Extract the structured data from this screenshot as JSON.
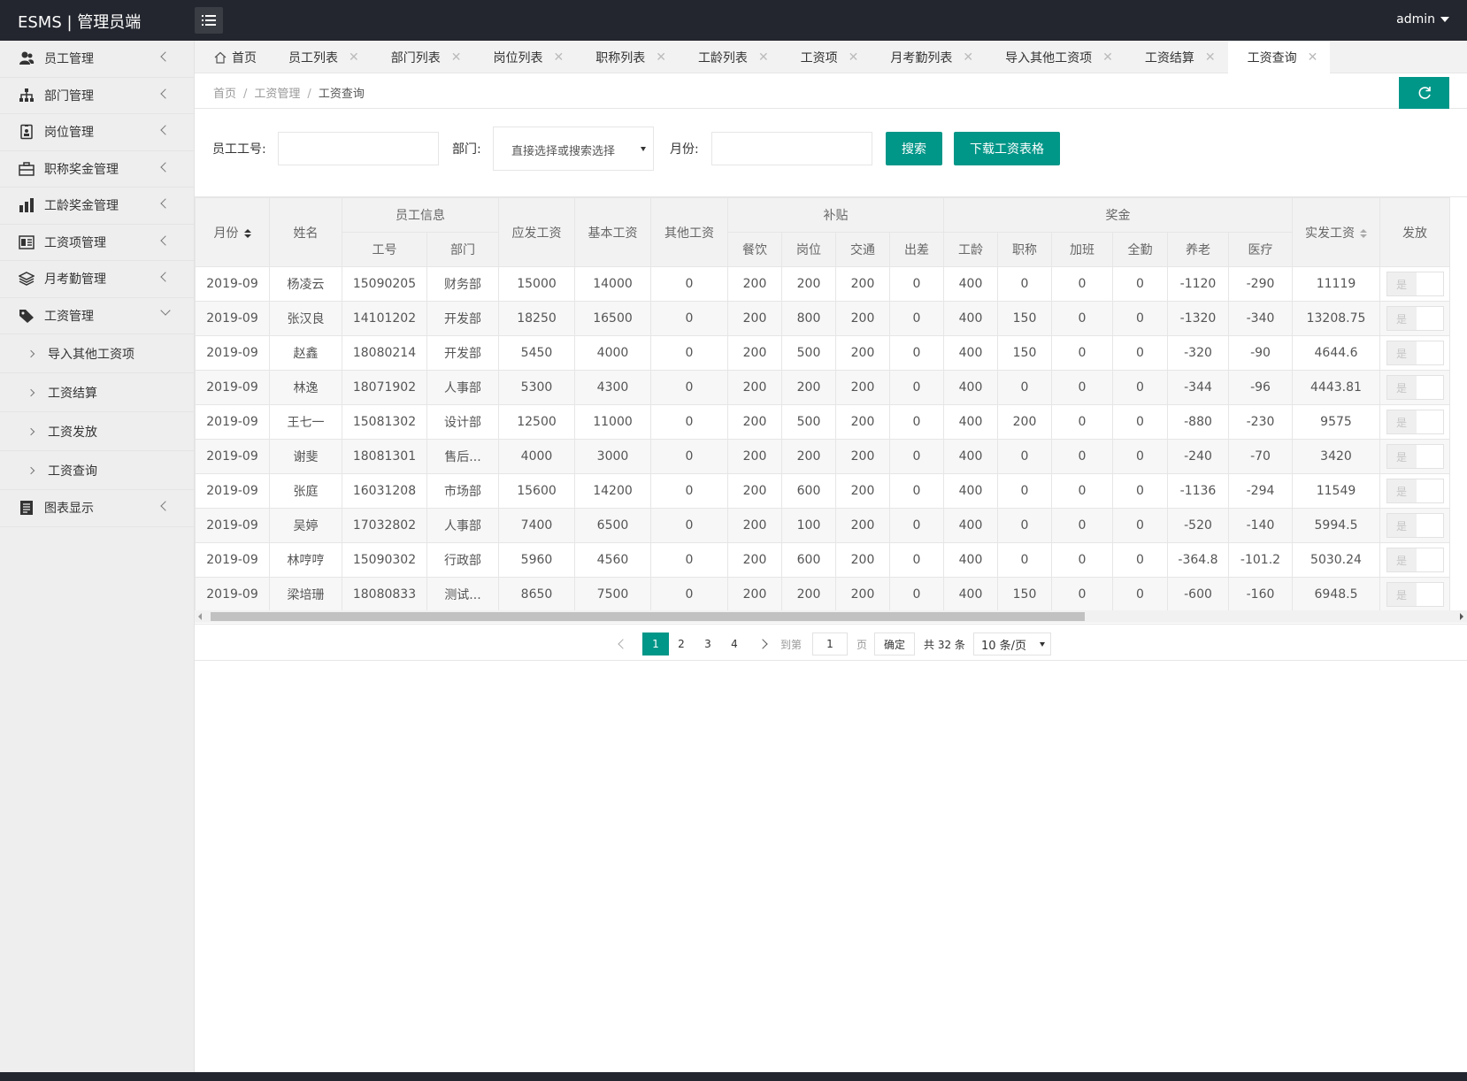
{
  "app": {
    "title": "ESMS | 管理员端",
    "user": "admin"
  },
  "sidebar": {
    "items": [
      {
        "label": "员工管理",
        "icon": "users-icon"
      },
      {
        "label": "部门管理",
        "icon": "sitemap-icon"
      },
      {
        "label": "岗位管理",
        "icon": "id-badge-icon"
      },
      {
        "label": "职称奖金管理",
        "icon": "briefcase-icon"
      },
      {
        "label": "工龄奖金管理",
        "icon": "chart-icon"
      },
      {
        "label": "工资项管理",
        "icon": "list-box-icon"
      },
      {
        "label": "月考勤管理",
        "icon": "layers-icon"
      },
      {
        "label": "工资管理",
        "icon": "tag-icon"
      }
    ],
    "subitems": [
      {
        "label": "导入其他工资项"
      },
      {
        "label": "工资结算"
      },
      {
        "label": "工资发放"
      },
      {
        "label": "工资查询"
      }
    ],
    "last": {
      "label": "图表显示",
      "icon": "report-icon"
    }
  },
  "tabs": [
    {
      "label": "首页"
    },
    {
      "label": "员工列表"
    },
    {
      "label": "部门列表"
    },
    {
      "label": "岗位列表"
    },
    {
      "label": "职称列表"
    },
    {
      "label": "工龄列表"
    },
    {
      "label": "工资项"
    },
    {
      "label": "月考勤列表"
    },
    {
      "label": "导入其他工资项"
    },
    {
      "label": "工资结算"
    },
    {
      "label": "工资查询"
    }
  ],
  "close_glyph": "✕",
  "breadcrumb": {
    "home": "首页",
    "sep": "/",
    "parent": "工资管理",
    "current": "工资查询"
  },
  "search": {
    "emp_label": "员工工号:",
    "emp_value": "",
    "dept_label": "部门:",
    "dept_placeholder": "直接选择或搜索选择",
    "month_label": "月份:",
    "month_value": "",
    "search_btn": "搜索",
    "download_btn": "下载工资表格"
  },
  "table": {
    "headers": {
      "month": "月份",
      "name": "姓名",
      "emp_info": "员工信息",
      "emp_no": "工号",
      "dept": "部门",
      "gross": "应发工资",
      "base": "基本工资",
      "other": "其他工资",
      "allowance": "补贴",
      "meal": "餐饮",
      "post": "岗位",
      "traffic": "交通",
      "trip": "出差",
      "bonus": "奖金",
      "seniority": "工龄",
      "title": "职称",
      "overtime": "加班",
      "attendance": "全勤",
      "pension": "养老",
      "medical": "医疗",
      "net": "实发工资",
      "issued": "发放"
    },
    "switch_label": "是",
    "rows": [
      [
        "2019-09",
        "杨凌云",
        "15090205",
        "财务部",
        "15000",
        "14000",
        "0",
        "200",
        "200",
        "200",
        "0",
        "400",
        "0",
        "0",
        "0",
        "-1120",
        "-290",
        "11119"
      ],
      [
        "2019-09",
        "张汉良",
        "14101202",
        "开发部",
        "18250",
        "16500",
        "0",
        "200",
        "800",
        "200",
        "0",
        "400",
        "150",
        "0",
        "0",
        "-1320",
        "-340",
        "13208.75"
      ],
      [
        "2019-09",
        "赵鑫",
        "18080214",
        "开发部",
        "5450",
        "4000",
        "0",
        "200",
        "500",
        "200",
        "0",
        "400",
        "150",
        "0",
        "0",
        "-320",
        "-90",
        "4644.6"
      ],
      [
        "2019-09",
        "林逸",
        "18071902",
        "人事部",
        "5300",
        "4300",
        "0",
        "200",
        "200",
        "200",
        "0",
        "400",
        "0",
        "0",
        "0",
        "-344",
        "-96",
        "4443.81"
      ],
      [
        "2019-09",
        "王七一",
        "15081302",
        "设计部",
        "12500",
        "11000",
        "0",
        "200",
        "500",
        "200",
        "0",
        "400",
        "200",
        "0",
        "0",
        "-880",
        "-230",
        "9575"
      ],
      [
        "2019-09",
        "谢斐",
        "18081301",
        "售后...",
        "4000",
        "3000",
        "0",
        "200",
        "200",
        "200",
        "0",
        "400",
        "0",
        "0",
        "0",
        "-240",
        "-70",
        "3420"
      ],
      [
        "2019-09",
        "张庭",
        "16031208",
        "市场部",
        "15600",
        "14200",
        "0",
        "200",
        "600",
        "200",
        "0",
        "400",
        "0",
        "0",
        "0",
        "-1136",
        "-294",
        "11549"
      ],
      [
        "2019-09",
        "吴婷",
        "17032802",
        "人事部",
        "7400",
        "6500",
        "0",
        "200",
        "100",
        "200",
        "0",
        "400",
        "0",
        "0",
        "0",
        "-520",
        "-140",
        "5994.5"
      ],
      [
        "2019-09",
        "林哼哼",
        "15090302",
        "行政部",
        "5960",
        "4560",
        "0",
        "200",
        "600",
        "200",
        "0",
        "400",
        "0",
        "0",
        "0",
        "-364.8",
        "-101.2",
        "5030.24"
      ],
      [
        "2019-09",
        "梁培珊",
        "18080833",
        "测试...",
        "8650",
        "7500",
        "0",
        "200",
        "200",
        "200",
        "0",
        "400",
        "150",
        "0",
        "0",
        "-600",
        "-160",
        "6948.5"
      ]
    ]
  },
  "pagination": {
    "pages": [
      "1",
      "2",
      "3",
      "4"
    ],
    "goto_label": "到第",
    "goto_value": "1",
    "page_unit": "页",
    "confirm": "确定",
    "total": "共 32 条",
    "per_page": "10 条/页"
  },
  "colors": {
    "accent": "#009688",
    "topbar": "#23262e"
  }
}
